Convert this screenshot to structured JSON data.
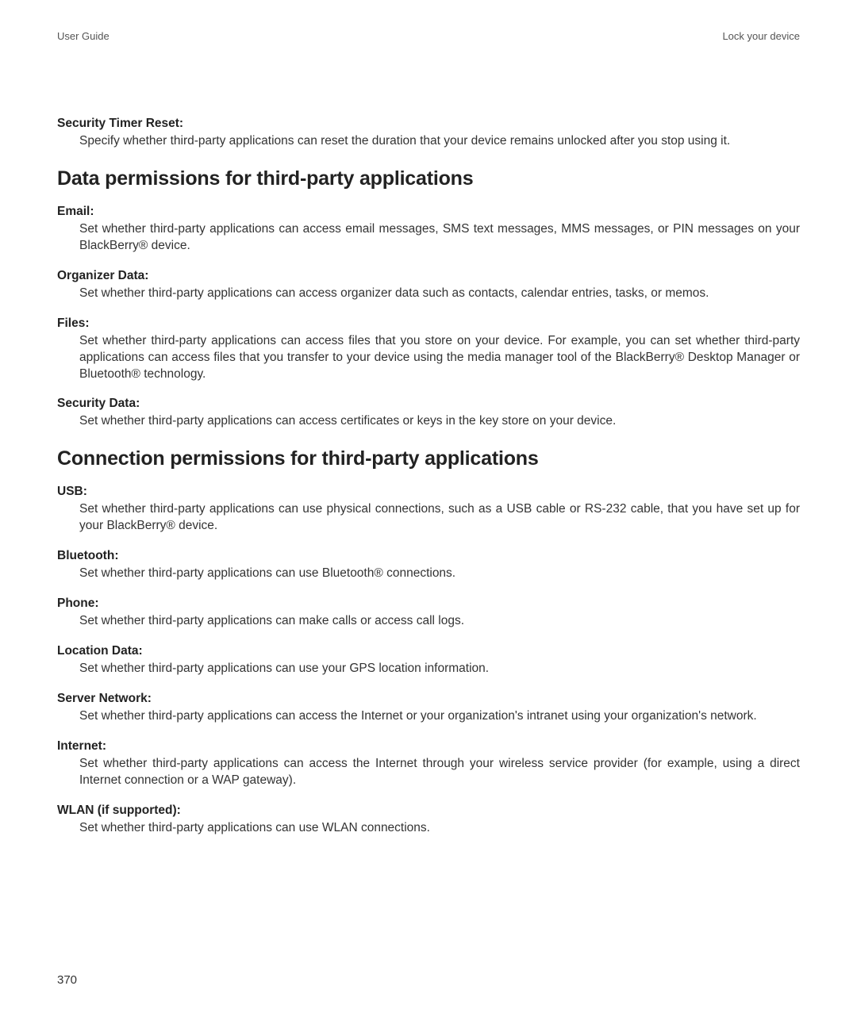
{
  "header": {
    "left": "User Guide",
    "right": "Lock your device"
  },
  "top_block": {
    "term": "Security Timer Reset:",
    "desc": "Specify whether third-party applications can reset the duration that your device remains unlocked after you stop using it."
  },
  "section_data": {
    "heading": "Data permissions for third-party applications",
    "items": [
      {
        "term": "Email:",
        "desc": "Set whether third-party applications can access email messages, SMS text messages, MMS messages, or PIN messages on your BlackBerry® device."
      },
      {
        "term": "Organizer Data:",
        "desc": "Set whether third-party applications can access organizer data such as contacts, calendar entries, tasks, or memos."
      },
      {
        "term": "Files:",
        "desc": "Set whether third-party applications can access files that you store on your device. For example, you can set whether third-party applications can access files that you transfer to your device using the media manager tool of the BlackBerry® Desktop Manager or Bluetooth® technology."
      },
      {
        "term": "Security Data:",
        "desc": "Set whether third-party applications can access certificates or keys in the key store on your device."
      }
    ]
  },
  "section_conn": {
    "heading": "Connection permissions for third-party applications",
    "items": [
      {
        "term": "USB:",
        "desc": "Set whether third-party applications can use physical connections, such as a USB cable or RS-232 cable, that you have set up for your BlackBerry® device."
      },
      {
        "term": "Bluetooth:",
        "desc": "Set whether third-party applications can use Bluetooth® connections."
      },
      {
        "term": "Phone:",
        "desc": "Set whether third-party applications can make calls or access call logs."
      },
      {
        "term": "Location Data:",
        "desc": "Set whether third-party applications can use your GPS location information."
      },
      {
        "term": "Server Network:",
        "desc": "Set whether third-party applications can access the Internet or your organization's intranet using your organization's network."
      },
      {
        "term": "Internet:",
        "desc": "Set whether third-party applications can access the Internet through your wireless service provider (for example, using a direct Internet connection or a WAP gateway)."
      },
      {
        "term": "WLAN (if supported):",
        "desc": "Set whether third-party applications can use WLAN connections."
      }
    ]
  },
  "page_number": "370"
}
